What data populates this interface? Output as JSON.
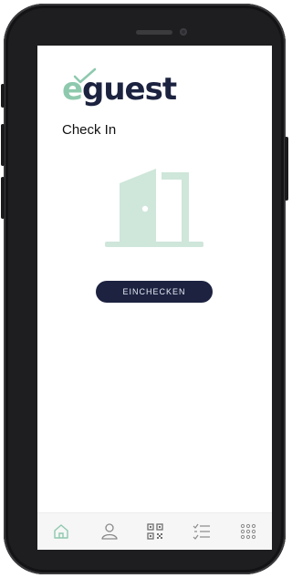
{
  "app": {
    "logo": {
      "prefix": "e",
      "rest": "guest"
    },
    "page_title": "Check In"
  },
  "actions": {
    "checkin_label": "EINCHECKEN"
  },
  "tabbar": {
    "items": [
      {
        "icon": "home-icon",
        "active": true
      },
      {
        "icon": "user-icon",
        "active": false
      },
      {
        "icon": "qr-code-icon",
        "active": false
      },
      {
        "icon": "checklist-icon",
        "active": false
      },
      {
        "icon": "grid-dots-icon",
        "active": false
      }
    ]
  },
  "colors": {
    "accent": "#8ec9ae",
    "brand_dark": "#1c2240",
    "icon_muted": "#8a8a8a",
    "door": "#cfe6da"
  }
}
